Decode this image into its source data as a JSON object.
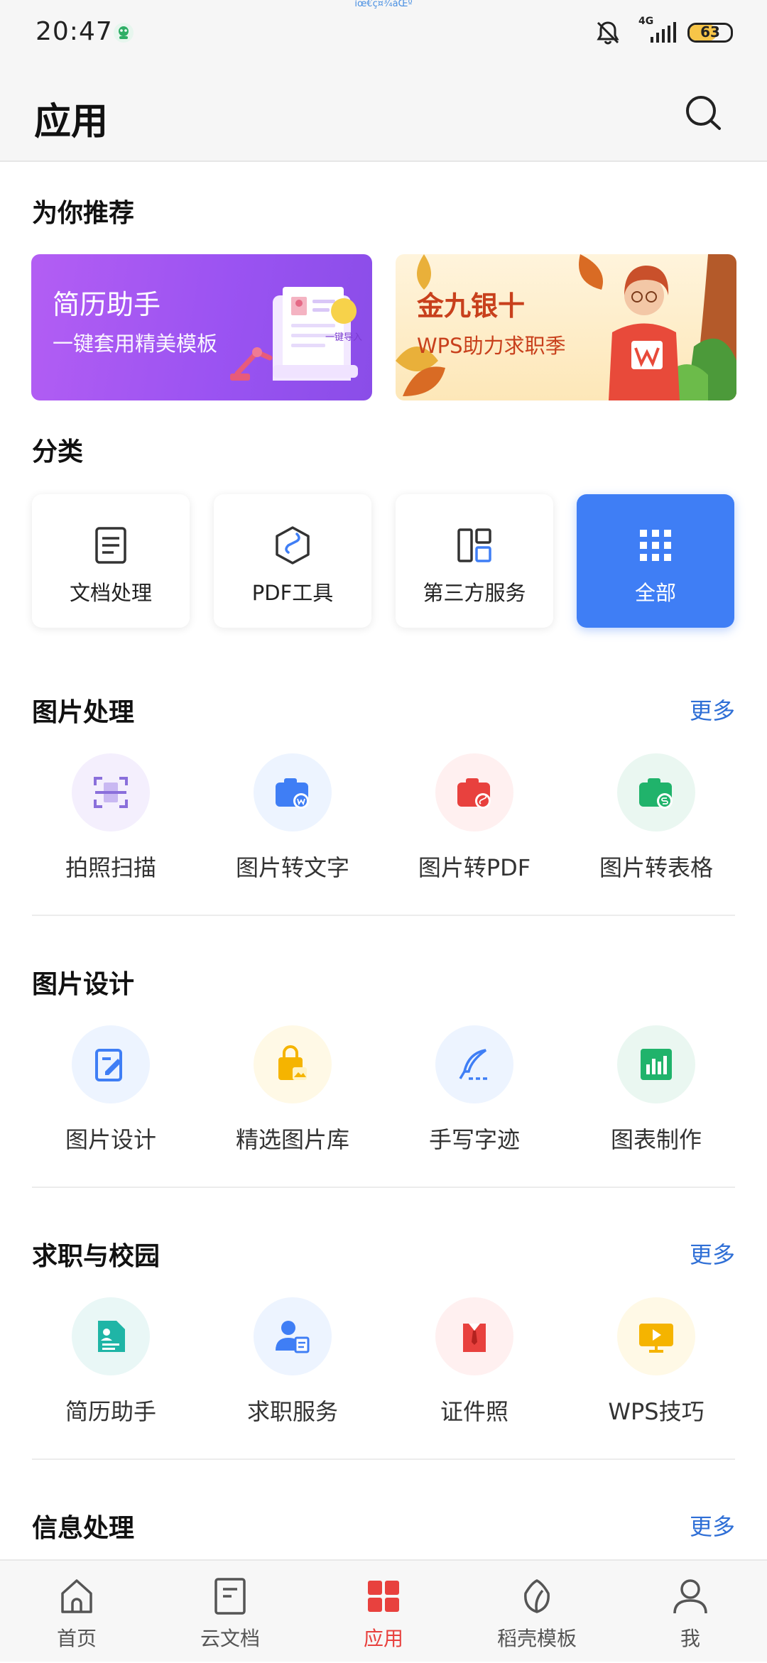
{
  "status_bar": {
    "time": "20:47",
    "notice": "ìœ€ç¤¾åŒº",
    "network": "4G",
    "battery": "63",
    "battery_level": 0.63
  },
  "header": {
    "title": "应用"
  },
  "recommend": {
    "title": "为你推荐",
    "banners": [
      {
        "title": "简历助手",
        "subtitle": "一键套用精美模板",
        "stamp": "一键导入"
      },
      {
        "title": "金九银十",
        "subtitle": "WPS助力求职季"
      }
    ]
  },
  "categories": {
    "title": "分类",
    "items": [
      {
        "label": "文档处理",
        "icon": "document-icon"
      },
      {
        "label": "PDF工具",
        "icon": "pdf-hexagon-icon"
      },
      {
        "label": "第三方服务",
        "icon": "layout-icon"
      },
      {
        "label": "全部",
        "icon": "grid-dots-icon"
      }
    ]
  },
  "sections": [
    {
      "title": "图片处理",
      "more": "更多",
      "items": [
        {
          "label": "拍照扫描",
          "icon": "scan-icon",
          "bg": "#f4effd",
          "color": "#8a6fdb"
        },
        {
          "label": "图片转文字",
          "icon": "camera-w-icon",
          "bg": "#edf4ff",
          "color": "#3f7ef5"
        },
        {
          "label": "图片转PDF",
          "icon": "camera-pdf-icon",
          "bg": "#fff0f0",
          "color": "#e8413e"
        },
        {
          "label": "图片转表格",
          "icon": "camera-s-icon",
          "bg": "#eaf7f1",
          "color": "#20b36b"
        }
      ]
    },
    {
      "title": "图片设计",
      "more": "",
      "items": [
        {
          "label": "图片设计",
          "icon": "design-icon",
          "bg": "#edf4ff",
          "color": "#3f7ef5"
        },
        {
          "label": "精选图片库",
          "icon": "image-bag-icon",
          "bg": "#fff9e6",
          "color": "#f5b400"
        },
        {
          "label": "手写字迹",
          "icon": "feather-pen-icon",
          "bg": "#edf4ff",
          "color": "#3f7ef5"
        },
        {
          "label": "图表制作",
          "icon": "bar-chart-icon",
          "bg": "#eaf7f1",
          "color": "#20b36b"
        }
      ]
    },
    {
      "title": "求职与校园",
      "more": "更多",
      "items": [
        {
          "label": "简历助手",
          "icon": "resume-icon",
          "bg": "#e9f7f6",
          "color": "#1fb5a6"
        },
        {
          "label": "求职服务",
          "icon": "job-person-icon",
          "bg": "#edf4ff",
          "color": "#3f7ef5"
        },
        {
          "label": "证件照",
          "icon": "id-shirt-icon",
          "bg": "#fff0f0",
          "color": "#e8413e"
        },
        {
          "label": "WPS技巧",
          "icon": "play-video-icon",
          "bg": "#fff9e6",
          "color": "#f5b400"
        }
      ]
    },
    {
      "title": "信息处理",
      "more": "更多",
      "items": []
    }
  ],
  "bottom_nav": [
    {
      "label": "首页",
      "icon": "home-icon"
    },
    {
      "label": "云文档",
      "icon": "cloud-doc-icon"
    },
    {
      "label": "应用",
      "icon": "apps-icon",
      "active": true
    },
    {
      "label": "稻壳模板",
      "icon": "leaf-icon"
    },
    {
      "label": "我",
      "icon": "profile-icon"
    }
  ],
  "colors": {
    "accent": "#3f7ef5",
    "active_nav": "#e8413e",
    "more_link": "#2f6fd6"
  }
}
